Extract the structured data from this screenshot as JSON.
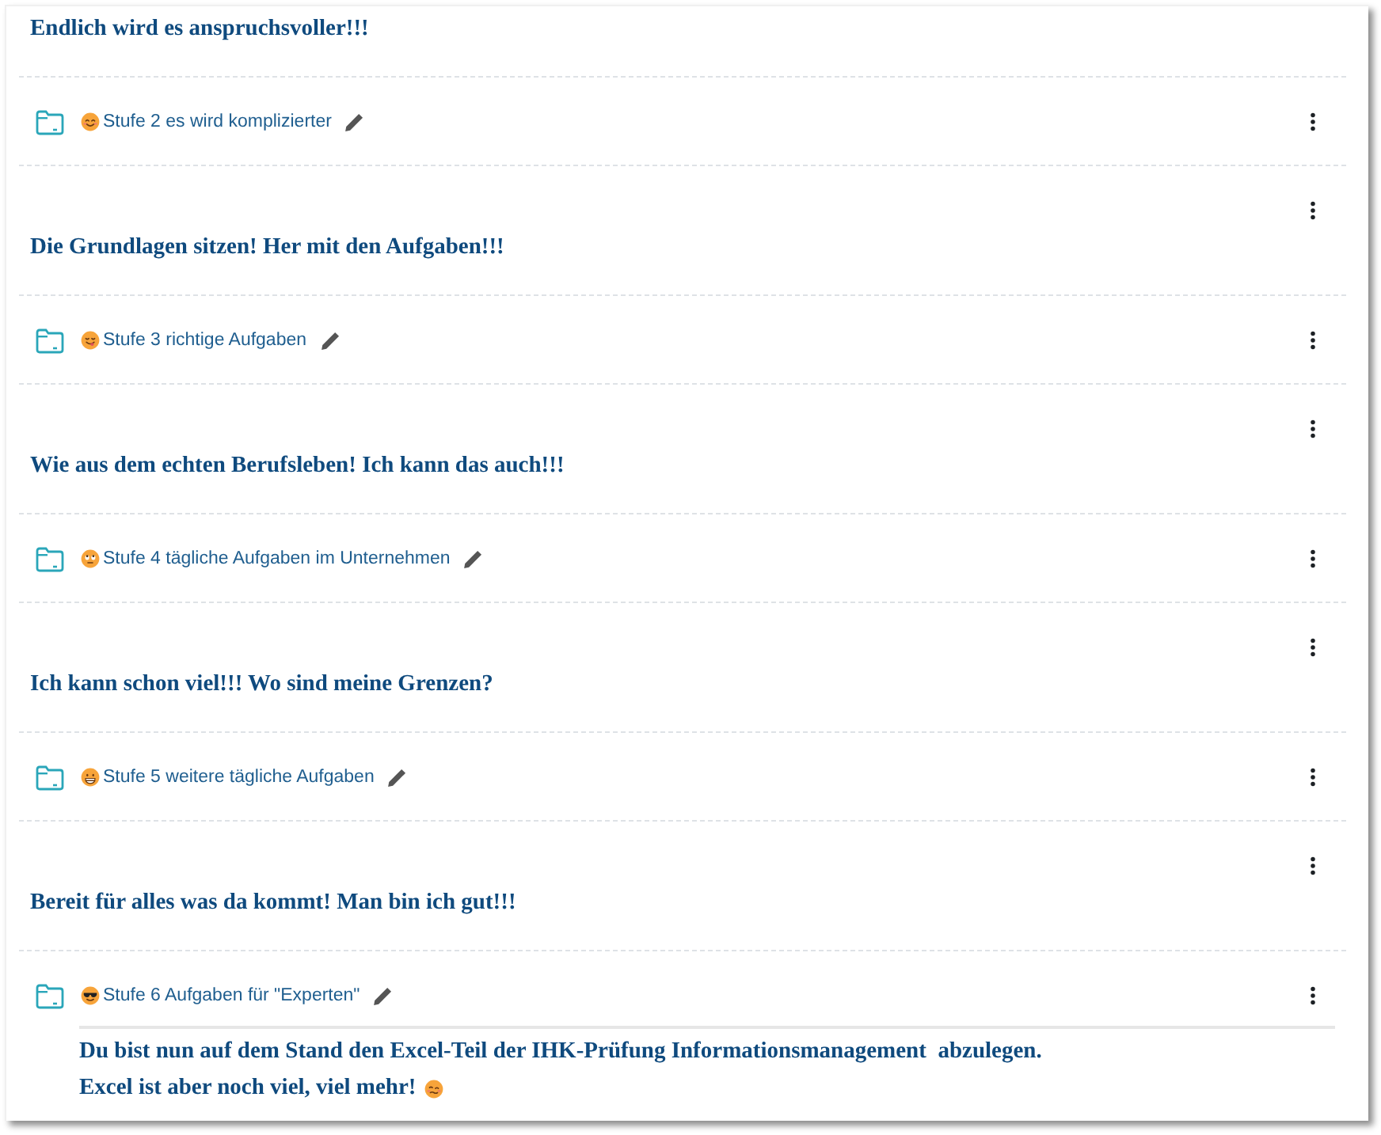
{
  "sections": [
    {
      "title": "Endlich wird es anspruchsvoller!!!",
      "menu": false,
      "activities": [
        {
          "name": "Stufe 2 es wird komplizierter",
          "kind": "smiling"
        }
      ]
    },
    {
      "title": "Die Grundlagen sitzen! Her mit den Aufgaben!!!",
      "menu": true,
      "activities": [
        {
          "name": "Stufe 3 richtige Aufgaben",
          "kind": "tongue"
        }
      ]
    },
    {
      "title": "Wie aus dem echten Berufsleben! Ich kann das auch!!!",
      "menu": true,
      "activities": [
        {
          "name": "Stufe 4 tägliche Aufgaben im Unternehmen",
          "kind": "eyeroll"
        }
      ]
    },
    {
      "title": "Ich kann schon viel!!! Wo sind meine Grenzen?",
      "menu": true,
      "activities": [
        {
          "name": "Stufe 5 weitere tägliche Aufgaben",
          "kind": "grin"
        }
      ]
    },
    {
      "title": "Bereit für alles was da kommt! Man bin ich gut!!!",
      "menu": true,
      "activities": [
        {
          "name": "Stufe 6 Aufgaben für \"Experten\"",
          "kind": "sunglasses",
          "description": {
            "lines": [
              "Du bist nun auf dem Stand den Excel-Teil der IHK-Prüfung Informationsmanagement  abzulegen.",
              "Excel ist aber noch viel, viel mehr!"
            ],
            "kind": "woozy"
          }
        }
      ]
    }
  ]
}
